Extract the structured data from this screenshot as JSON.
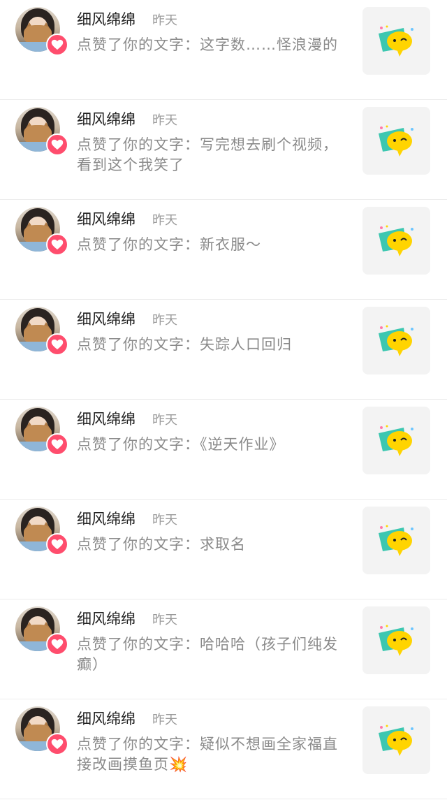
{
  "notifications": [
    {
      "name": "细风绵绵",
      "time": "昨天",
      "text": "点赞了你的文字：这字数……怪浪漫的"
    },
    {
      "name": "细风绵绵",
      "time": "昨天",
      "text": "点赞了你的文字：写完想去刷个视频，看到这个我笑了"
    },
    {
      "name": "细风绵绵",
      "time": "昨天",
      "text": "点赞了你的文字：新衣服～"
    },
    {
      "name": "细风绵绵",
      "time": "昨天",
      "text": "点赞了你的文字：失踪人口回归"
    },
    {
      "name": "细风绵绵",
      "time": "昨天",
      "text": "点赞了你的文字：《逆天作业》"
    },
    {
      "name": "细风绵绵",
      "time": "昨天",
      "text": "点赞了你的文字：求取名"
    },
    {
      "name": "细风绵绵",
      "time": "昨天",
      "text": "点赞了你的文字：哈哈哈（孩子们纯发癫）"
    },
    {
      "name": "细风绵绵",
      "time": "昨天",
      "text": "点赞了你的文字：疑似不想画全家福直接改画摸鱼页💥"
    }
  ],
  "icons": {
    "badge": "heart-icon",
    "thumbnail": "chat-bubble-emoji-icon"
  },
  "colors": {
    "like_badge": "#ff4d6d",
    "bubble_yellow": "#ffd400",
    "bubble_teal": "#3cc7b0"
  }
}
